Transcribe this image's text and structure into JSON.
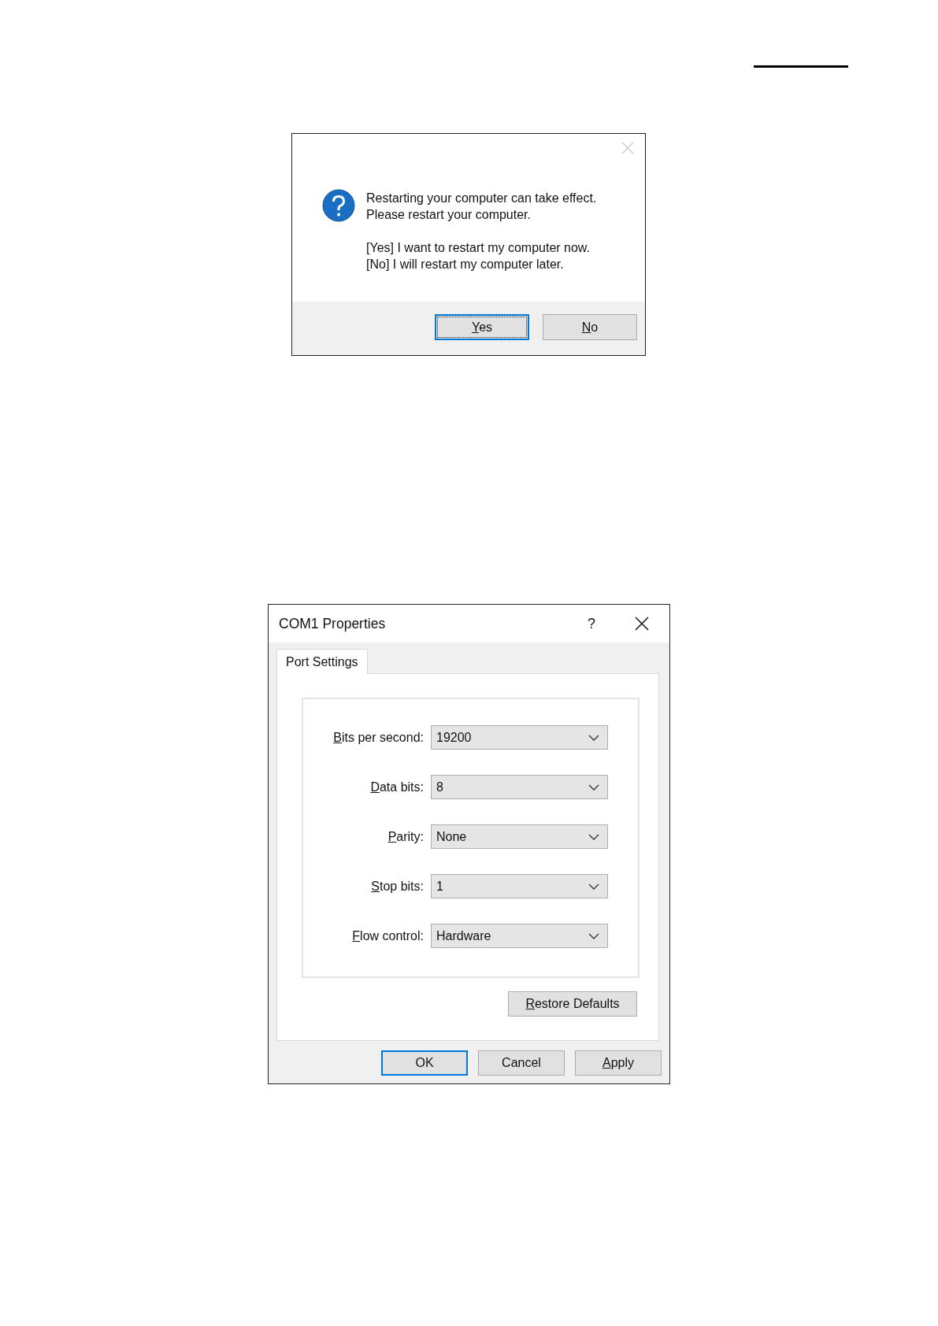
{
  "restart_prompt": {
    "close_disabled": true,
    "message": [
      "Restarting your computer can take effect.",
      "Please restart your computer."
    ],
    "options": [
      "[Yes] I want to restart my computer now.",
      "[No] I will restart my computer later."
    ],
    "buttons": [
      {
        "label": "Yes",
        "access_key": true,
        "default": true,
        "focused": true
      },
      {
        "label": "No",
        "access_key": true,
        "default": false,
        "focused": false
      }
    ]
  },
  "properties_dialog": {
    "title": "COM1 Properties",
    "help_button": "?",
    "tabs": [
      {
        "label": "Port Settings",
        "selected": true
      }
    ],
    "fields": [
      {
        "label": "Bits per second:",
        "access_key": true,
        "value": "19200"
      },
      {
        "label": "Data bits:",
        "access_key": true,
        "value": "8"
      },
      {
        "label": "Parity:",
        "access_key": true,
        "value": "None"
      },
      {
        "label": "Stop bits:",
        "access_key": true,
        "value": "1"
      },
      {
        "label": "Flow control:",
        "access_key": true,
        "value": "Hardware"
      }
    ],
    "restore_button": {
      "label": "Restore Defaults",
      "access_key": true
    },
    "buttons": [
      {
        "label": "OK",
        "access_key": false,
        "default": true,
        "focused": false
      },
      {
        "label": "Cancel",
        "access_key": false,
        "default": false,
        "focused": false
      },
      {
        "label": "Apply",
        "access_key": true,
        "default": false,
        "focused": false
      }
    ]
  }
}
